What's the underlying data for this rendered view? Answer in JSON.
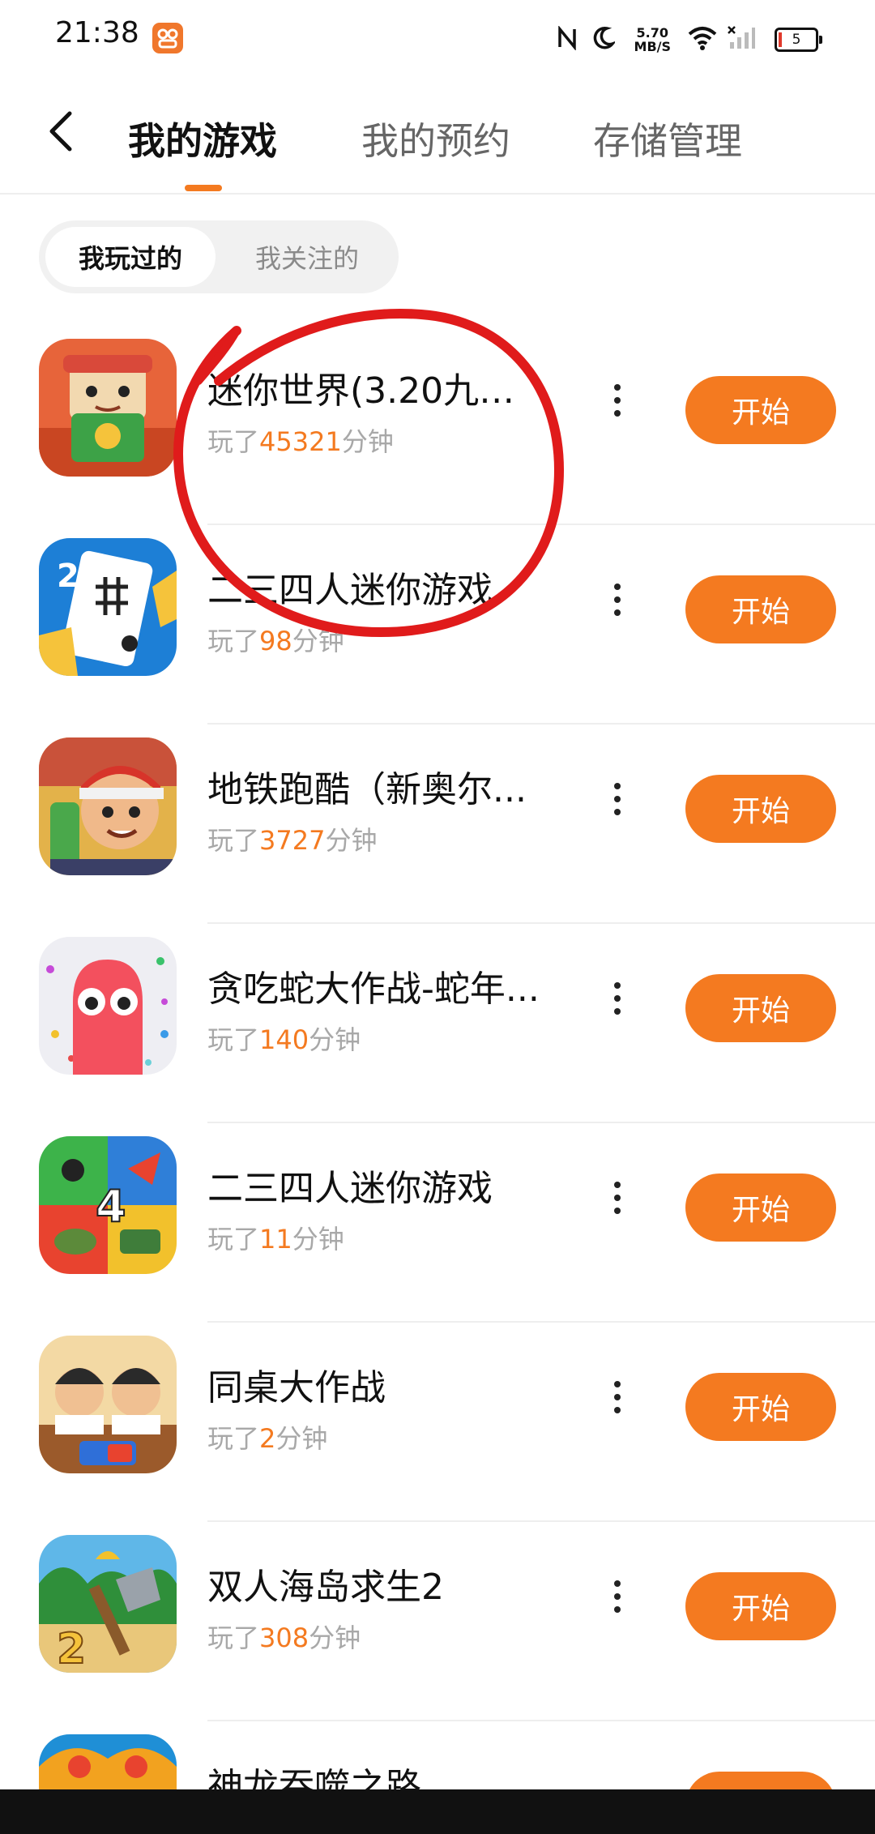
{
  "status_bar": {
    "time": "21:38",
    "speed_value": "5.70",
    "speed_unit": "MB/S",
    "battery": "5",
    "icons": [
      "app-notification-icon",
      "nfc-icon",
      "moon-icon",
      "wifi-icon",
      "signal-icon",
      "battery-icon"
    ]
  },
  "header": {
    "tabs": [
      {
        "label": "我的游戏",
        "active": true
      },
      {
        "label": "我的预约",
        "active": false
      },
      {
        "label": "存储管理",
        "active": false
      }
    ]
  },
  "filter": {
    "options": [
      "我玩过的",
      "我关注的"
    ],
    "selected": "我玩过的"
  },
  "played_prefix": "玩了",
  "minutes_suffix": "分钟",
  "start_label": "开始",
  "games": [
    {
      "title": "迷你世界(3.20九周...",
      "minutes": "45321"
    },
    {
      "title": "二三四人迷你游戏",
      "minutes": "98"
    },
    {
      "title": "地铁跑酷（新奥尔...",
      "minutes": "3727"
    },
    {
      "title": "贪吃蛇大作战-蛇年...",
      "minutes": "140"
    },
    {
      "title": "二三四人迷你游戏",
      "minutes": "11"
    },
    {
      "title": "同桌大作战",
      "minutes": "2"
    },
    {
      "title": "双人海岛求生2",
      "minutes": "308"
    },
    {
      "title": "神龙吞噬之路",
      "minutes": ""
    }
  ],
  "colors": {
    "accent": "#f47a20",
    "annotation": "#e01b1b"
  }
}
